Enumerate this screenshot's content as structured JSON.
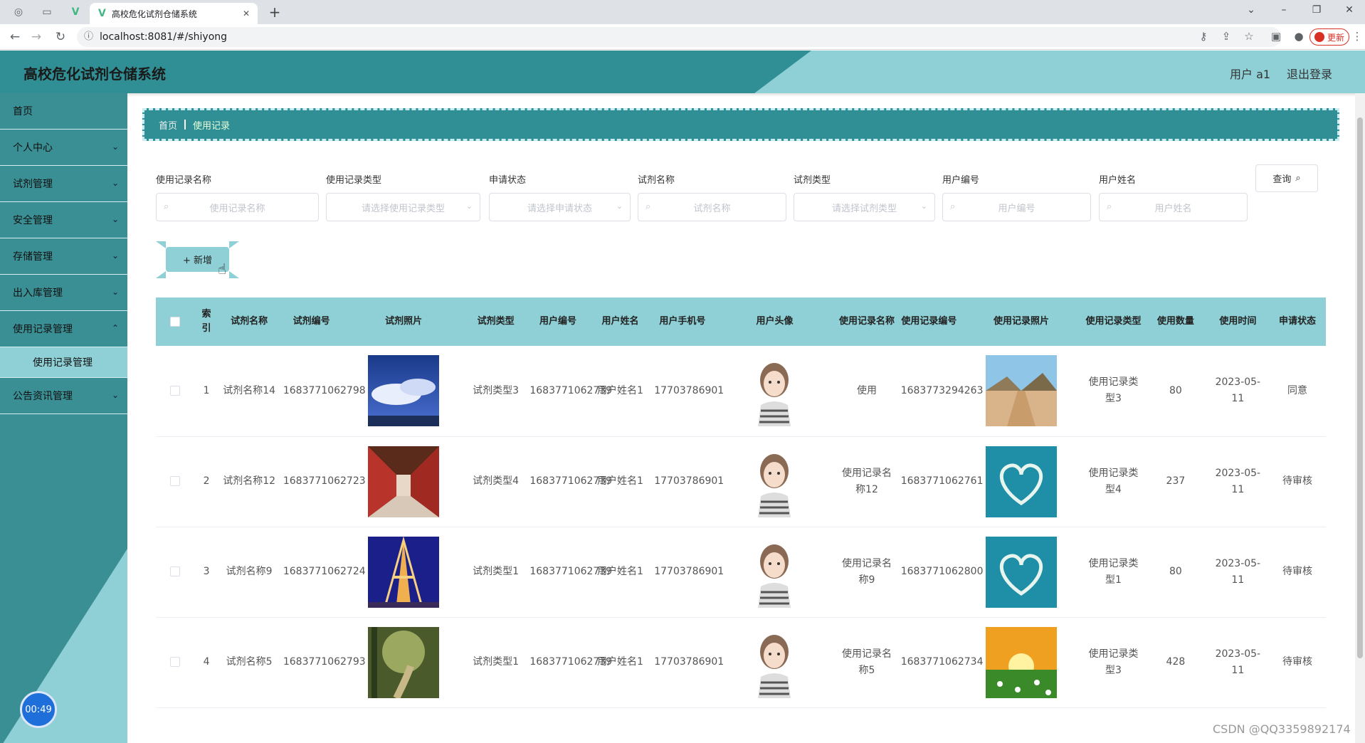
{
  "browser": {
    "tab_title": "高校危化试剂仓储系统",
    "tab_favicon": "V",
    "url": "localhost:8081/#/shiyong",
    "update_label": "更新"
  },
  "header": {
    "app_title": "高校危化试剂仓储系统",
    "user_label": "用户 a1",
    "logout_label": "退出登录",
    "primary_color": "#2f8f95",
    "accent_color": "#8fd0d6"
  },
  "sidebar": {
    "items": [
      {
        "label": "首页"
      },
      {
        "label": "个人中心"
      },
      {
        "label": "试剂管理"
      },
      {
        "label": "安全管理"
      },
      {
        "label": "存储管理"
      },
      {
        "label": "出入库管理"
      },
      {
        "label": "使用记录管理"
      },
      {
        "label": "使用记录管理"
      },
      {
        "label": "公告资讯管理"
      }
    ],
    "timer": "00:49"
  },
  "breadcrumb": {
    "home": "首页",
    "current": "使用记录"
  },
  "filters": [
    {
      "label": "使用记录名称",
      "placeholder": "使用记录名称"
    },
    {
      "label": "使用记录类型",
      "placeholder": "请选择使用记录类型"
    },
    {
      "label": "申请状态",
      "placeholder": "请选择申请状态"
    },
    {
      "label": "试剂名称",
      "placeholder": "试剂名称"
    },
    {
      "label": "试剂类型",
      "placeholder": "请选择试剂类型"
    },
    {
      "label": "用户编号",
      "placeholder": "用户编号"
    },
    {
      "label": "用户姓名",
      "placeholder": "用户姓名"
    }
  ],
  "query_label": "查询",
  "add_label": "+ 新增",
  "table": {
    "headers": [
      "索引",
      "试剂名称",
      "试剂编号",
      "试剂照片",
      "试剂类型",
      "用户编号",
      "用户姓名",
      "用户手机号",
      "用户头像",
      "使用记录名称",
      "使用记录编号",
      "使用记录照片",
      "使用记录类型",
      "使用数量",
      "使用时间",
      "申请状态"
    ],
    "rows": [
      {
        "index": "1",
        "reagent_name": "试剂名称14",
        "reagent_no": "1683771062798",
        "reagent_photo": "sky-clouds",
        "reagent_type": "试剂类型3",
        "user_no": "1683771062739",
        "user_name": "用户姓名1",
        "phone": "17703786901",
        "avatar": "girl-avatar",
        "record_name": "使用",
        "record_no": "1683773294263",
        "record_photo": "desert-road",
        "record_type": "使用记录类型3",
        "qty": "80",
        "time": "2023-05-11",
        "status": "同意"
      },
      {
        "index": "2",
        "reagent_name": "试剂名称12",
        "reagent_no": "1683771062723",
        "reagent_photo": "corridor",
        "reagent_type": "试剂类型4",
        "user_no": "1683771062739",
        "user_name": "用户姓名1",
        "phone": "17703786901",
        "avatar": "girl-avatar",
        "record_name": "使用记录名称12",
        "record_no": "1683771062761",
        "record_photo": "heart-island",
        "record_type": "使用记录类型4",
        "qty": "237",
        "time": "2023-05-11",
        "status": "待审核"
      },
      {
        "index": "3",
        "reagent_name": "试剂名称9",
        "reagent_no": "1683771062724",
        "reagent_photo": "eiffel-tower",
        "reagent_type": "试剂类型1",
        "user_no": "1683771062739",
        "user_name": "用户姓名1",
        "phone": "17703786901",
        "avatar": "girl-avatar",
        "record_name": "使用记录名称9",
        "record_no": "1683771062800",
        "record_photo": "heart-island",
        "record_type": "使用记录类型1",
        "qty": "80",
        "time": "2023-05-11",
        "status": "待审核"
      },
      {
        "index": "4",
        "reagent_name": "试剂名称5",
        "reagent_no": "1683771062793",
        "reagent_photo": "forest-path",
        "reagent_type": "试剂类型1",
        "user_no": "1683771062739",
        "user_name": "用户姓名1",
        "phone": "17703786901",
        "avatar": "girl-avatar",
        "record_name": "使用记录名称5",
        "record_no": "1683771062734",
        "record_photo": "sunset-flowers",
        "record_type": "使用记录类型3",
        "qty": "428",
        "time": "2023-05-11",
        "status": "待审核"
      }
    ]
  },
  "watermark": "CSDN @QQ3359892174"
}
